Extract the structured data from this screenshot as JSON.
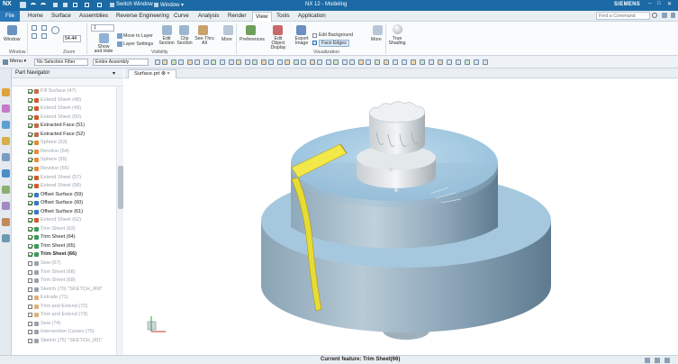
{
  "titlebar": {
    "app_logo": "NX",
    "quick_switch": "Switch Window",
    "window_menu": "Window ▾",
    "title": "NX 12 - Modeling",
    "brand": "SIEMENS",
    "colors": {
      "bar": "#1b6aa5"
    }
  },
  "menubar": {
    "tabs": [
      "File",
      "Home",
      "Surface",
      "Assemblies",
      "Reverse Engineering",
      "Curve",
      "Analysis",
      "Render",
      "View",
      "Tools",
      "Application"
    ],
    "active_tab": "View",
    "search_placeholder": "Find a Command"
  },
  "ribbon": {
    "window_label": "Window",
    "zoom_value": "54.44",
    "buttons": [
      "Show and Hide",
      "Move to Layer",
      "Layer Settings",
      "Edit Section",
      "Clip Section",
      "See-Thru All",
      "More",
      "Preferences",
      "Edit Object Display",
      "Export Image",
      "True Shading",
      "More"
    ],
    "checkboxes": [
      "Edit Background",
      "Face Edges"
    ],
    "groups": [
      "Window",
      "Zoom",
      "Visibility",
      "Visualization"
    ],
    "zoom_dropdown": "1"
  },
  "selection_bar": {
    "menu_label": "Menu ▾",
    "filter": "No Selection Filter",
    "scope": "Entire Assembly"
  },
  "navigator": {
    "title": "Part Navigator",
    "items": [
      {
        "label": "Fill Surface (47)",
        "checked": true,
        "dim": true,
        "bold": false,
        "icon": "#c46a4a"
      },
      {
        "label": "Extend Sheet (48)",
        "checked": true,
        "dim": true,
        "bold": false,
        "icon": "#d05a2a"
      },
      {
        "label": "Extend Sheet (49)",
        "checked": true,
        "dim": true,
        "bold": false,
        "icon": "#d05a2a"
      },
      {
        "label": "Extend Sheet (50)",
        "checked": true,
        "dim": true,
        "bold": false,
        "icon": "#d05a2a"
      },
      {
        "label": "Extracted Face (51)",
        "checked": true,
        "dim": false,
        "bold": false,
        "icon": "#c46a4a"
      },
      {
        "label": "Extracted Face (52)",
        "checked": true,
        "dim": false,
        "bold": false,
        "icon": "#c46a4a"
      },
      {
        "label": "Sphere (53)",
        "checked": true,
        "dim": true,
        "bold": false,
        "icon": "#e08c3a"
      },
      {
        "label": "Revolve (54)",
        "checked": true,
        "dim": true,
        "bold": false,
        "icon": "#e08c3a"
      },
      {
        "label": "Sphere (55)",
        "checked": true,
        "dim": true,
        "bold": false,
        "icon": "#e08c3a"
      },
      {
        "label": "Revolve (56)",
        "checked": true,
        "dim": true,
        "bold": false,
        "icon": "#e08c3a"
      },
      {
        "label": "Extend Sheet (57)",
        "checked": true,
        "dim": true,
        "bold": false,
        "icon": "#d05a2a"
      },
      {
        "label": "Extend Sheet (58)",
        "checked": true,
        "dim": true,
        "bold": false,
        "icon": "#d05a2a"
      },
      {
        "label": "Offset Surface (59)",
        "checked": true,
        "dim": false,
        "bold": false,
        "icon": "#3a78c2"
      },
      {
        "label": "Offset Surface (60)",
        "checked": true,
        "dim": false,
        "bold": false,
        "icon": "#3a78c2"
      },
      {
        "label": "Offset Surface (61)",
        "checked": true,
        "dim": false,
        "bold": false,
        "icon": "#3a78c2"
      },
      {
        "label": "Extend Sheet (62)",
        "checked": true,
        "dim": true,
        "bold": false,
        "icon": "#d05a2a"
      },
      {
        "label": "Trim Sheet (63)",
        "checked": true,
        "dim": true,
        "bold": false,
        "icon": "#3a9a5a"
      },
      {
        "label": "Trim Sheet (64)",
        "checked": true,
        "dim": false,
        "bold": false,
        "icon": "#3a9a5a"
      },
      {
        "label": "Trim Sheet (65)",
        "checked": true,
        "dim": false,
        "bold": false,
        "icon": "#3a9a5a"
      },
      {
        "label": "Trim Sheet (66)",
        "checked": true,
        "dim": false,
        "bold": true,
        "icon": "#3a9a5a"
      },
      {
        "label": "Sew (67)",
        "checked": false,
        "dim": true,
        "bold": false,
        "icon": "#9aa3ad"
      },
      {
        "label": "Trim Sheet (68)",
        "checked": false,
        "dim": true,
        "bold": false,
        "icon": "#9aa3ad"
      },
      {
        "label": "Trim Sheet (69)",
        "checked": false,
        "dim": true,
        "bold": false,
        "icon": "#9aa3ad"
      },
      {
        "label": "Sketch (70) \"SKETCH_000\"",
        "checked": false,
        "dim": true,
        "bold": false,
        "icon": "#9aa3ad"
      },
      {
        "label": "Extrude (71)",
        "checked": false,
        "dim": true,
        "bold": false,
        "icon": "#e0b07a"
      },
      {
        "label": "Trim and Extend (72)",
        "checked": false,
        "dim": true,
        "bold": false,
        "icon": "#e0b07a"
      },
      {
        "label": "Trim and Extend (73)",
        "checked": false,
        "dim": true,
        "bold": false,
        "icon": "#e0b07a"
      },
      {
        "label": "Sew (74)",
        "checked": false,
        "dim": true,
        "bold": false,
        "icon": "#9aa3ad"
      },
      {
        "label": "Intersection Curves (75)",
        "checked": false,
        "dim": true,
        "bold": false,
        "icon": "#9aa3ad"
      },
      {
        "label": "Sketch (76) \"SKETCH_001\"",
        "checked": false,
        "dim": true,
        "bold": false,
        "icon": "#9aa3ad"
      }
    ]
  },
  "document": {
    "tab_label": "Surface.prt ⊗ ×"
  },
  "status": {
    "current_feature": "Current feature: Trim Sheet(66)"
  }
}
